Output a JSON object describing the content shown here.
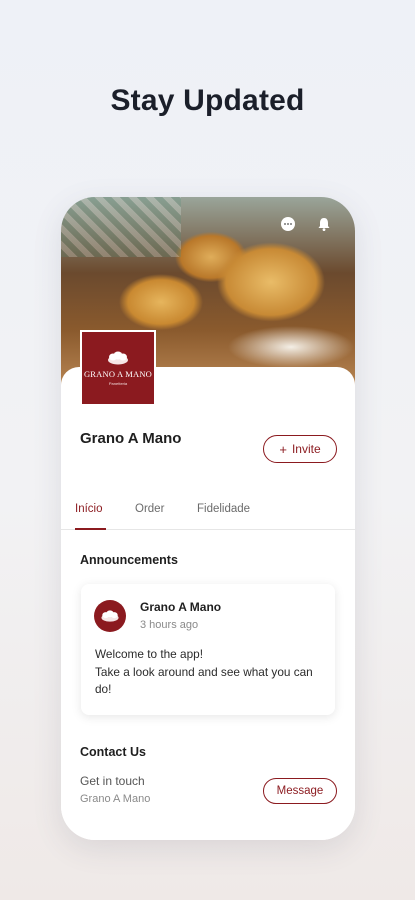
{
  "headline": "Stay Updated",
  "hero": {
    "chat_icon": "chat-bubble-icon",
    "bell_icon": "bell-icon"
  },
  "business": {
    "logo_name": "GRANO A MANO",
    "logo_sub": "Panetteria",
    "name": "Grano A Mano",
    "invite_label": "Invite"
  },
  "tabs": [
    {
      "label": "Início",
      "active": true
    },
    {
      "label": "Order",
      "active": false
    },
    {
      "label": "Fidelidade",
      "active": false
    }
  ],
  "announcements": {
    "title": "Announcements",
    "post": {
      "author": "Grano A Mano",
      "time": "3 hours ago",
      "body_line1": "Welcome to the app!",
      "body_line2": "Take a look around and see what you can do!"
    }
  },
  "contact": {
    "title": "Contact Us",
    "label": "Get in touch",
    "sub": "Grano A Mano",
    "message_label": "Message"
  },
  "colors": {
    "brand": "#8b1a1f",
    "headline": "#1b1f2a"
  }
}
